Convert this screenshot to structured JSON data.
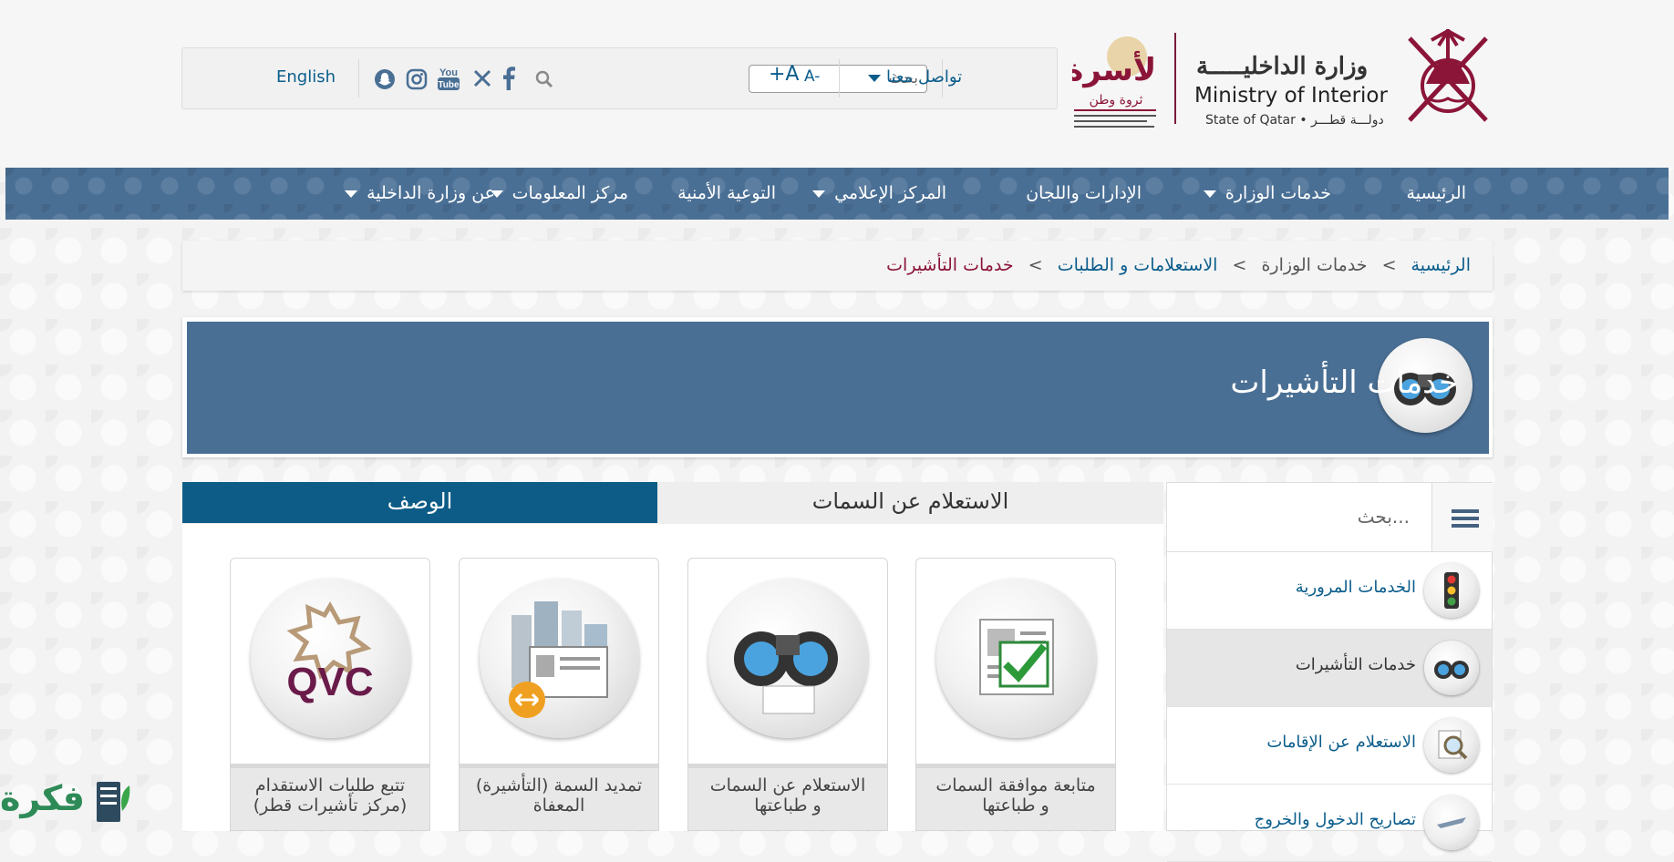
{
  "header": {
    "toolbar": {
      "contact_label": "تواصل معنا",
      "font_increase": "+A",
      "font_decrease": "A-",
      "search_placeholder": "بحث",
      "language_label": "English"
    },
    "family_logo": {
      "title": "الأسرة",
      "subtitle": "ثروة وطن"
    },
    "ministry": {
      "name_ar": "وزارة الداخليـــــة",
      "name_en": "Ministry of Interior",
      "state": "State of Qatar • دولـــة قطـــر"
    }
  },
  "nav": {
    "items": [
      {
        "label": "الرئيسية",
        "dropdown": false
      },
      {
        "label": "خدمات الوزارة",
        "dropdown": true
      },
      {
        "label": "الإدارات واللجان",
        "dropdown": false
      },
      {
        "label": "المركز الإعلامي",
        "dropdown": true
      },
      {
        "label": "التوعية الأمنية",
        "dropdown": false
      },
      {
        "label": "مركز المعلومات",
        "dropdown": true
      },
      {
        "label": "عن وزارة الداخلية",
        "dropdown": true
      }
    ]
  },
  "breadcrumb": {
    "separator": ">",
    "items": [
      "الرئيسية",
      "خدمات الوزارة",
      "الاستعلامات و الطلبات",
      "خدمات التأشيرات"
    ]
  },
  "banner": {
    "title": "خدمات التأشيرات",
    "icon": "binoculars-icon"
  },
  "sidebar": {
    "search_placeholder": "بحث...",
    "items": [
      {
        "label": "الخدمات المرورية",
        "icon": "traffic-light-icon",
        "active": false
      },
      {
        "label": "خدمات التأشيرات",
        "icon": "binoculars-icon",
        "active": true
      },
      {
        "label": "الاستعلام عن الإقامات",
        "icon": "magnifier-icon",
        "active": false
      },
      {
        "label": "تصاريح الدخول والخروج",
        "icon": "plane-icon",
        "active": false
      }
    ]
  },
  "tabs": {
    "description": "الوصف",
    "inquiry": "الاستعلام عن السمات"
  },
  "cards": [
    {
      "line1": "متابعة موافقة السمات",
      "line2": "و طباعتها",
      "icon": "approved-document-icon"
    },
    {
      "line1": "الاستعلام عن السمات",
      "line2": "و طباعتها",
      "icon": "binoculars-icon"
    },
    {
      "line1": "تمديد السمة (التأشيرة)",
      "line2": "المعفاة",
      "icon": "visa-extension-icon"
    },
    {
      "line1": "تتبع طلبات الاستقدام",
      "line2": "(مركز تأشيرات قطر)",
      "icon": "qvc-logo"
    }
  ],
  "watermark": {
    "text": "فكرة"
  },
  "colors": {
    "nav_blue": "#4a6f95",
    "tab_active": "#0d5c87",
    "maroon": "#8b1538",
    "link": "#0b5d8c"
  }
}
